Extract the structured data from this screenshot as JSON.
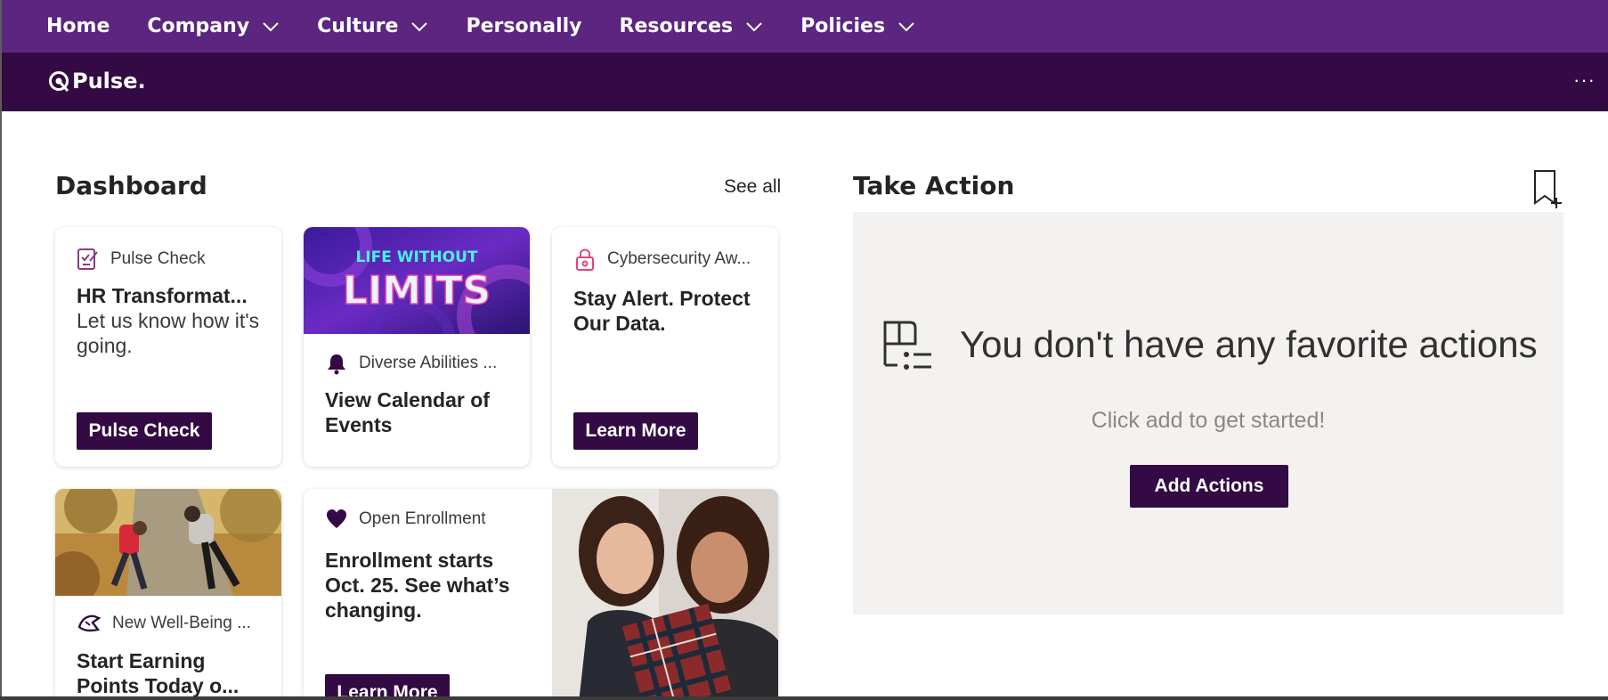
{
  "nav": {
    "items": [
      {
        "label": "Home",
        "has_menu": false
      },
      {
        "label": "Company",
        "has_menu": true
      },
      {
        "label": "Culture",
        "has_menu": true
      },
      {
        "label": "Personally",
        "has_menu": false
      },
      {
        "label": "Resources",
        "has_menu": true
      },
      {
        "label": "Policies",
        "has_menu": true
      }
    ]
  },
  "brand": {
    "name": "Pulse.",
    "more_icon": "ellipsis-icon",
    "more": "···"
  },
  "dashboard": {
    "title": "Dashboard",
    "see_all": "See all",
    "cards": [
      {
        "category": "Pulse Check",
        "icon": "survey-icon",
        "title": "HR Transformat...",
        "body": "Let us know how it's going.",
        "button": "Pulse Check"
      },
      {
        "image_text": "LIFE WITHOUT LIMITS",
        "category": "Diverse Abilities ...",
        "icon": "bell-icon",
        "title": "View Calendar of Events"
      },
      {
        "category": "Cybersecurity Aw...",
        "icon": "lock-icon",
        "title": "Stay Alert. Protect Our Data.",
        "button": "Learn More"
      },
      {
        "category": "New Well-Being ...",
        "icon": "sneaker-icon",
        "title": "Start Earning Points Today o..."
      },
      {
        "category": "Open Enrollment",
        "icon": "heart-icon",
        "title": "Enrollment starts Oct. 25. See what’s changing.",
        "button": "Learn More"
      }
    ]
  },
  "take_action": {
    "title": "Take Action",
    "bookmark_icon": "add-bookmark-icon",
    "empty_title": "You don't have any favorite actions",
    "empty_sub": "Click add to get started!",
    "button": "Add Actions"
  },
  "colors": {
    "nav_bg": "#5c2580",
    "brand_bg": "#330a44",
    "button_bg": "#330a44",
    "panel_bg": "#f3f2f1"
  }
}
